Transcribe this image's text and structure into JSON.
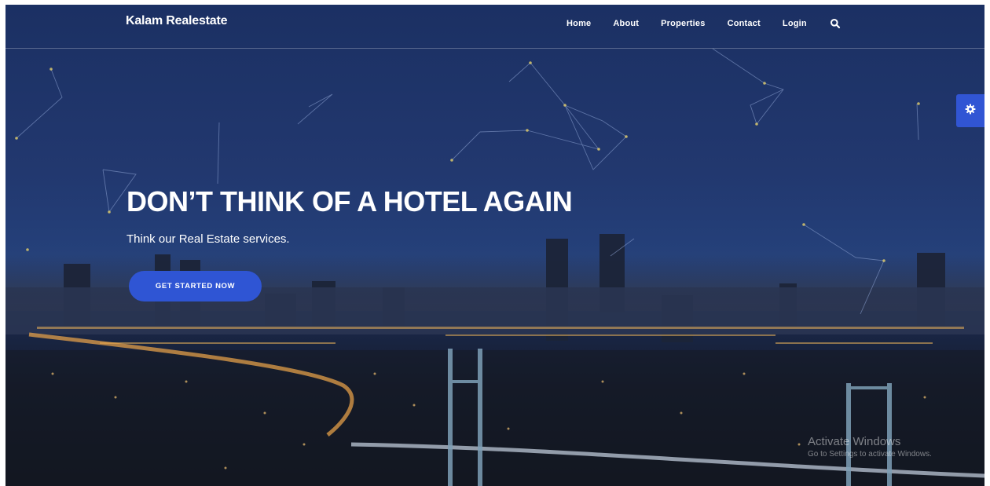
{
  "navbar": {
    "brand": "Kalam Realestate",
    "links": [
      "Home",
      "About",
      "Properties",
      "Contact",
      "Login"
    ],
    "search_icon": "search-icon"
  },
  "hero": {
    "title": "DON’T THINK OF A HOTEL AGAIN",
    "subtitle": "Think our Real Estate services.",
    "cta_label": "GET STARTED NOW"
  },
  "settings_tab": {
    "icon": "gear-icon"
  },
  "watermark": {
    "title": "Activate Windows",
    "subtitle": "Go to Settings to activate Windows."
  },
  "colors": {
    "accent": "#2f55d4",
    "sky_top": "#1b3063",
    "city_bottom": "#0f1219"
  }
}
